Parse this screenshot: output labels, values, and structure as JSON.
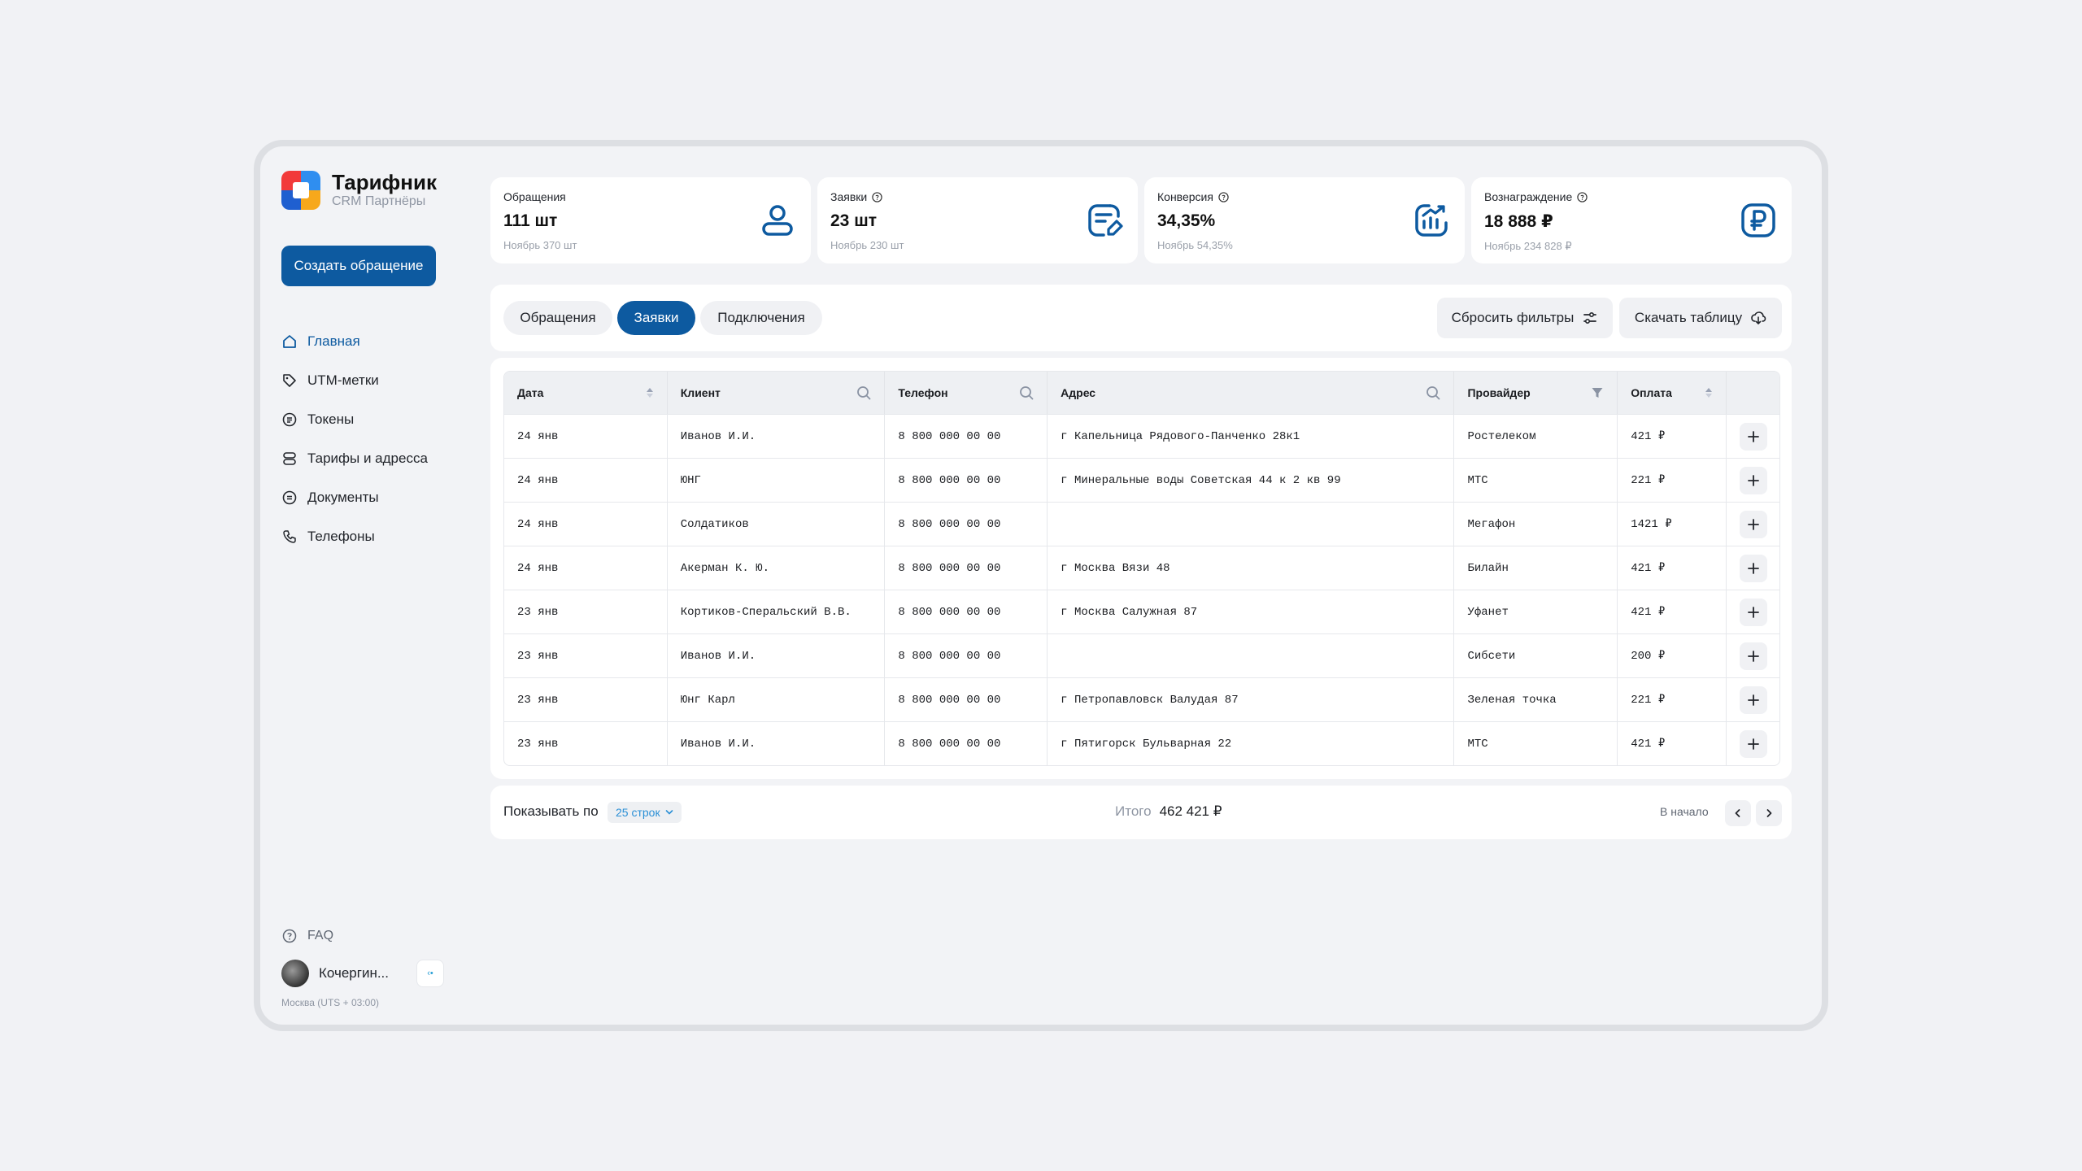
{
  "app": {
    "title": "Тарифник",
    "subtitle": "CRM Партнёры"
  },
  "sidebar": {
    "create_button": "Создать обращение",
    "items": [
      {
        "label": "Главная",
        "icon": "home-icon",
        "active": true
      },
      {
        "label": "UTM-метки",
        "icon": "tag-icon"
      },
      {
        "label": "Токены",
        "icon": "token-icon"
      },
      {
        "label": "Тарифы и адресса",
        "icon": "database-icon"
      },
      {
        "label": "Документы",
        "icon": "document-icon"
      },
      {
        "label": "Телефоны",
        "icon": "phone-icon"
      }
    ],
    "faq": "FAQ",
    "user_name": "Кочергин...",
    "timezone": "Москва (UTS + 03:00)"
  },
  "stats": [
    {
      "label": "Обращения",
      "value": "111 шт",
      "sub": "Ноябрь 370 шт",
      "icon": "user-icon"
    },
    {
      "label": "Заявки",
      "value": "23 шт",
      "sub": "Ноябрь 230 шт",
      "icon": "edit-document-icon"
    },
    {
      "label": "Конверсия",
      "value": "34,35%",
      "sub": "Ноябрь 54,35%",
      "icon": "growth-chart-icon"
    },
    {
      "label": "Вознаграждение",
      "value": "18 888 ₽",
      "sub": "Ноябрь 234 828 ₽",
      "icon": "ruble-icon"
    }
  ],
  "tabs": [
    "Обращения",
    "Заявки",
    "Подключения"
  ],
  "active_tab": "Заявки",
  "actions": {
    "reset": "Сбросить фильтры",
    "download": "Скачать таблицу"
  },
  "table": {
    "headers": [
      "Дата",
      "Клиент",
      "Телефон",
      "Адрес",
      "Провайдер",
      "Оплата"
    ],
    "rows": [
      [
        "24 янв",
        "Иванов И.И.",
        "8 800 000 00 00",
        "г Капельница Рядового-Панченко 28к1",
        "Ростелеком",
        "421 ₽"
      ],
      [
        "24 янв",
        "ЮНГ",
        "8 800 000 00 00",
        "г Минеральные воды Советская 44 к 2 кв 99",
        "МТС",
        "221 ₽"
      ],
      [
        "24 янв",
        "Солдатиков",
        "8 800 000 00 00",
        "",
        "Мегафон",
        "1421 ₽"
      ],
      [
        "24 янв",
        "Акерман К. Ю.",
        "8 800 000 00 00",
        "г Москва Вязи 48",
        "Билайн",
        "421 ₽"
      ],
      [
        "23 янв",
        "Кортиков-Сперальский В.В.",
        "8 800 000 00 00",
        "г Москва Салужная 87",
        "Уфанет",
        "421 ₽"
      ],
      [
        "23 янв",
        "Иванов И.И.",
        "8 800 000 00 00",
        "",
        "Сибсети",
        "200 ₽"
      ],
      [
        "23 янв",
        "Юнг Карл",
        "8 800 000 00 00",
        "г Петропавловск Валудая 87",
        "Зеленая точка",
        "221 ₽"
      ],
      [
        "23 янв",
        "Иванов И.И.",
        "8 800 000 00 00",
        "г Пятигорск Бульварная 22",
        "МТС",
        "421 ₽"
      ]
    ]
  },
  "footer": {
    "show_label": "Показывать по",
    "rows_option": "25 строк",
    "total_label": "Итого",
    "total_value": "462 421 ₽",
    "to_start": "В начало"
  },
  "colors": {
    "accent": "#0d5aa0",
    "background": "#f1f2f5",
    "link": "#2a8fd6"
  }
}
